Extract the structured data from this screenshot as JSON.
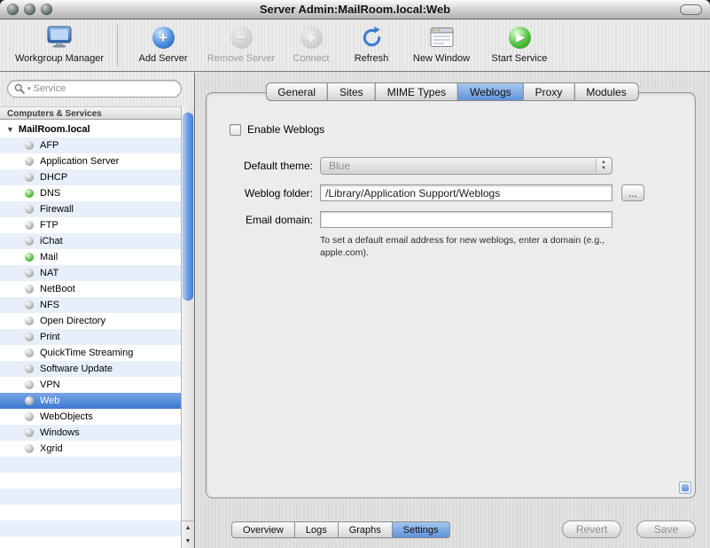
{
  "window": {
    "title": "Server Admin:MailRoom.local:Web"
  },
  "toolbar": {
    "items": [
      {
        "label": "Workgroup Manager",
        "enabled": true
      },
      {
        "label": "Add Server",
        "enabled": true
      },
      {
        "label": "Remove Server",
        "enabled": false
      },
      {
        "label": "Connect",
        "enabled": false
      },
      {
        "label": "Refresh",
        "enabled": true
      },
      {
        "label": "New Window",
        "enabled": true
      },
      {
        "label": "Start Service",
        "enabled": true
      }
    ],
    "glyphs": {
      "add": "+",
      "remove": "−",
      "play": "▶"
    }
  },
  "sidebar": {
    "search_placeholder": "Service",
    "header": "Computers & Services",
    "root": "MailRoom.local",
    "services": [
      {
        "name": "AFP",
        "status": "gray"
      },
      {
        "name": "Application Server",
        "status": "gray"
      },
      {
        "name": "DHCP",
        "status": "gray"
      },
      {
        "name": "DNS",
        "status": "green"
      },
      {
        "name": "Firewall",
        "status": "gray"
      },
      {
        "name": "FTP",
        "status": "gray"
      },
      {
        "name": "iChat",
        "status": "gray"
      },
      {
        "name": "Mail",
        "status": "green"
      },
      {
        "name": "NAT",
        "status": "gray"
      },
      {
        "name": "NetBoot",
        "status": "gray"
      },
      {
        "name": "NFS",
        "status": "gray"
      },
      {
        "name": "Open Directory",
        "status": "gray"
      },
      {
        "name": "Print",
        "status": "gray"
      },
      {
        "name": "QuickTime Streaming",
        "status": "gray"
      },
      {
        "name": "Software Update",
        "status": "gray"
      },
      {
        "name": "VPN",
        "status": "gray"
      },
      {
        "name": "Web",
        "status": "gray",
        "selected": true
      },
      {
        "name": "WebObjects",
        "status": "gray"
      },
      {
        "name": "Windows",
        "status": "gray"
      },
      {
        "name": "Xgrid",
        "status": "gray"
      }
    ]
  },
  "main": {
    "tabs": [
      {
        "label": "General"
      },
      {
        "label": "Sites"
      },
      {
        "label": "MIME Types"
      },
      {
        "label": "Weblogs",
        "selected": true
      },
      {
        "label": "Proxy"
      },
      {
        "label": "Modules"
      }
    ],
    "enable_label": "Enable Weblogs",
    "fields": {
      "default_theme_label": "Default theme:",
      "default_theme_value": "Blue",
      "weblog_folder_label": "Weblog folder:",
      "weblog_folder_value": "/Library/Application Support/Weblogs",
      "browse_label": "...",
      "email_domain_label": "Email domain:",
      "email_domain_value": "",
      "email_help": "To set a default email address for new weblogs, enter a domain (e.g., apple.com)."
    }
  },
  "bottom": {
    "views": [
      {
        "label": "Overview"
      },
      {
        "label": "Logs"
      },
      {
        "label": "Graphs"
      },
      {
        "label": "Settings",
        "selected": true
      }
    ],
    "revert_label": "Revert",
    "save_label": "Save"
  },
  "colors": {
    "selection_blue": "#3a77d2",
    "tab_selected_blue": "#5e93da",
    "status_green": "#2fae1f",
    "status_gray": "#9c9c9c"
  }
}
